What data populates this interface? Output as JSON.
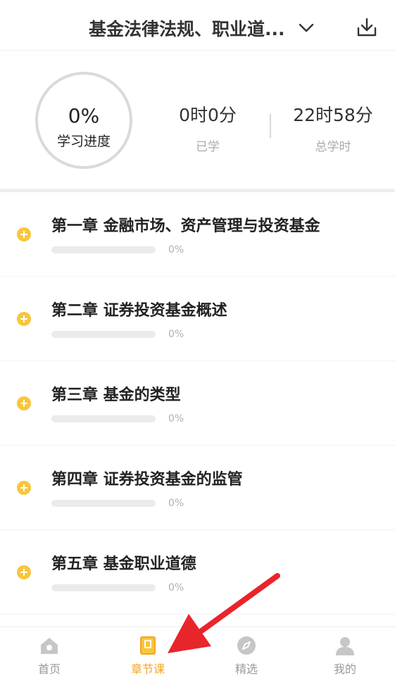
{
  "header": {
    "title": "基金法律法规、职业道...",
    "dropdown_icon": "chevron-down-icon",
    "download_icon": "download-icon"
  },
  "progress": {
    "percent_text": "0%",
    "percent_value": 0,
    "label": "学习进度",
    "learned_value": "0时0分",
    "learned_label": "已学",
    "total_value": "22时58分",
    "total_label": "总学时"
  },
  "chapters": [
    {
      "title": "第一章 金融市场、资产管理与投资基金",
      "progress_text": "0%",
      "progress": 0
    },
    {
      "title": "第二章 证券投资基金概述",
      "progress_text": "0%",
      "progress": 0
    },
    {
      "title": "第三章 基金的类型",
      "progress_text": "0%",
      "progress": 0
    },
    {
      "title": "第四章 证券投资基金的监管",
      "progress_text": "0%",
      "progress": 0
    },
    {
      "title": "第五章 基金职业道德",
      "progress_text": "0%",
      "progress": 0
    }
  ],
  "tabbar": {
    "items": [
      {
        "label": "首页",
        "icon": "home-icon",
        "active": false
      },
      {
        "label": "章节课",
        "icon": "book-icon",
        "active": true
      },
      {
        "label": "精选",
        "icon": "compass-icon",
        "active": false
      },
      {
        "label": "我的",
        "icon": "user-icon",
        "active": false
      }
    ]
  },
  "colors": {
    "accent": "#f5a623",
    "annotation_arrow": "#e8252b"
  }
}
